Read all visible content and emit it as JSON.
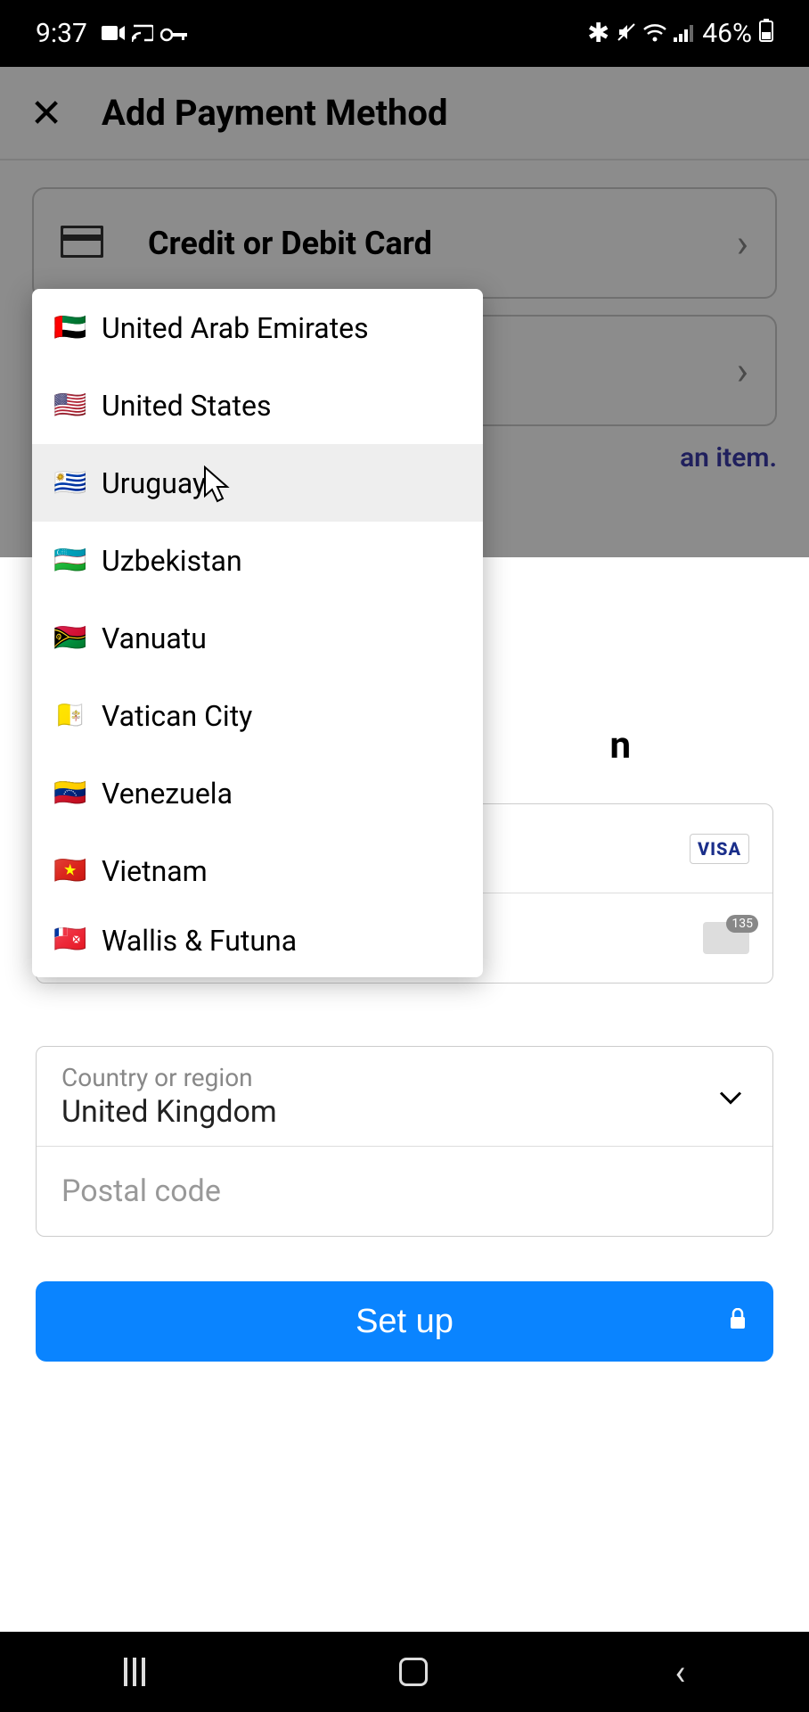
{
  "status_bar": {
    "time": "9:37",
    "battery_pct": "46%",
    "left_icons": [
      "camera-icon",
      "cast-icon",
      "key-icon"
    ],
    "right_icons": [
      "bluetooth-icon",
      "mute-icon",
      "wifi-icon",
      "signal-icon"
    ]
  },
  "header": {
    "title": "Add Payment Method"
  },
  "payment_options": {
    "card_label": "Credit or Debit Card"
  },
  "partial_text": {
    "visible_fragment_1": "an item.",
    "visible_fragment_2": "n"
  },
  "form": {
    "card_brand": "VISA",
    "cvc_hint": "135",
    "country_label": "Country or region",
    "country_value": "United Kingdom",
    "postal_placeholder": "Postal code"
  },
  "primary_button": {
    "label": "Set up"
  },
  "dropdown": {
    "items": [
      {
        "flag": "🇦🇪",
        "name": "United Arab Emirates",
        "hovered": false
      },
      {
        "flag": "🇺🇸",
        "name": "United States",
        "hovered": false
      },
      {
        "flag": "🇺🇾",
        "name": "Uruguay",
        "hovered": true
      },
      {
        "flag": "🇺🇿",
        "name": "Uzbekistan",
        "hovered": false
      },
      {
        "flag": "🇻🇺",
        "name": "Vanuatu",
        "hovered": false
      },
      {
        "flag": "🇻🇦",
        "name": "Vatican City",
        "hovered": false
      },
      {
        "flag": "🇻🇪",
        "name": "Venezuela",
        "hovered": false
      },
      {
        "flag": "🇻🇳",
        "name": "Vietnam",
        "hovered": false
      },
      {
        "flag": "🇼🇫",
        "name": "Wallis & Futuna",
        "hovered": false
      }
    ]
  }
}
